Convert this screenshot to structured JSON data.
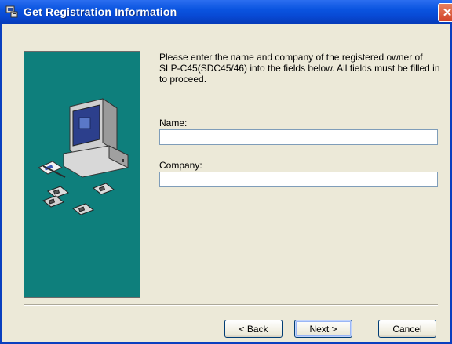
{
  "window": {
    "title": "Get Registration Information",
    "close_label": "✕"
  },
  "content": {
    "instructions": "Please enter the name and company of the registered owner of SLP-C45(SDC45/46) into the fields below. All fields must be filled in to proceed.",
    "name_label": "Name:",
    "name_value": "",
    "company_label": "Company:",
    "company_value": ""
  },
  "buttons": {
    "back": "< Back",
    "next": "Next >",
    "cancel": "Cancel"
  },
  "colors": {
    "panel": "#0e7f7c",
    "titlebar": "#0a54e0"
  }
}
